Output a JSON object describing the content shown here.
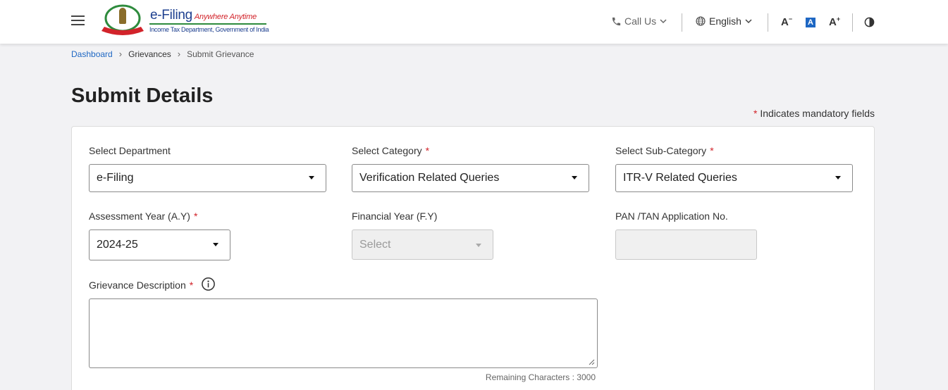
{
  "header": {
    "logo_title": "e-Filing",
    "logo_tagline": "Anywhere Anytime",
    "logo_subtitle": "Income Tax Department, Government of India",
    "call_us": "Call Us",
    "language": "English",
    "font_decrease": "A",
    "font_reset": "A",
    "font_increase": "A"
  },
  "breadcrumb": {
    "dashboard": "Dashboard",
    "grievances": "Grievances",
    "current": "Submit Grievance"
  },
  "page": {
    "title": "Submit Details",
    "mandatory_note": "Indicates mandatory fields"
  },
  "form": {
    "department": {
      "label": "Select Department",
      "value": "e-Filing"
    },
    "category": {
      "label": "Select Category",
      "value": "Verification Related Queries"
    },
    "subcategory": {
      "label": "Select Sub-Category",
      "value": "ITR-V Related Queries"
    },
    "assessment_year": {
      "label": "Assessment Year (A.Y)",
      "value": "2024-25"
    },
    "financial_year": {
      "label": "Financial Year (F.Y)",
      "value": "Select"
    },
    "pan_tan": {
      "label": "PAN /TAN Application No.",
      "value": ""
    },
    "description": {
      "label": "Grievance Description",
      "value": ""
    },
    "remaining_chars": "Remaining Characters : 3000"
  },
  "colors": {
    "accent": "#1e67c3",
    "required": "#d2232a",
    "logo_green": "#2e8b3d"
  }
}
